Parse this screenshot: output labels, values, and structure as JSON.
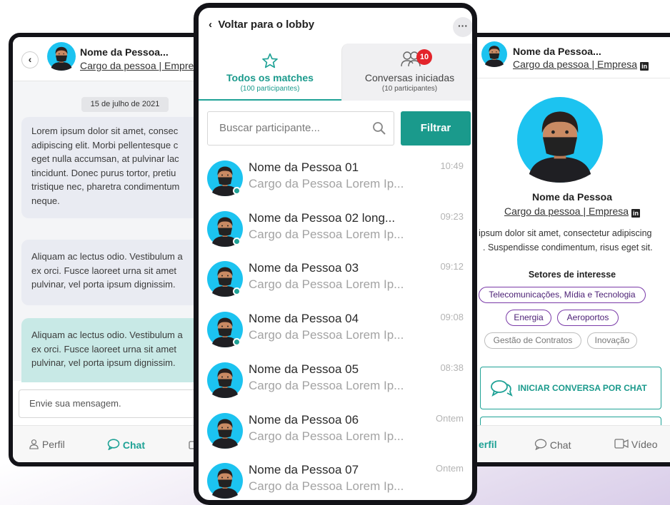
{
  "colors": {
    "teal": "#1fa296",
    "purple": "#7a3aa8",
    "badge": "#e3242b"
  },
  "left": {
    "name": "Nome da Pessoa...",
    "cargo": "Cargo da pessoa | Empre",
    "date": "15 de julho de 2021",
    "messages": [
      {
        "lines": [
          "Lorem ipsum dolor sit amet, consec",
          "adipiscing elit. Morbi pellentesque c",
          "eget nulla accumsan, at pulvinar lac",
          "tincidunt. Donec purus tortor, pretiu",
          "tristique nec, pharetra condimentum",
          "neque."
        ]
      },
      {
        "lines": [
          "Aliquam ac lectus odio. Vestibulum a",
          "ex orci. Fusce laoreet urna sit amet",
          "pulvinar, vel porta ipsum dignissim."
        ]
      },
      {
        "lines": [
          "Aliquam ac lectus odio. Vestibulum a",
          "ex orci. Fusce laoreet urna sit amet",
          "pulvinar, vel porta ipsum dignissim."
        ]
      }
    ],
    "input_placeholder": "Envie sua mensagem.",
    "tab_perfil": "Perfil",
    "tab_chat": "Chat"
  },
  "center": {
    "back": "Voltar para o lobby",
    "tab_all": "Todos os matches",
    "tab_all_count": "(100 participantes)",
    "tab_conv": "Conversas iniciadas",
    "tab_conv_count": "(10 participantes)",
    "badge": "10",
    "search_placeholder": "Buscar participante...",
    "filter": "Filtrar",
    "rows": [
      {
        "name": "Nome da Pessoa 01",
        "cargo": "Cargo da Pessoa Lorem Ip...",
        "time": "10:49",
        "online": true
      },
      {
        "name": "Nome da Pessoa 02 long...",
        "cargo": "Cargo da Pessoa Lorem Ip...",
        "time": "09:23",
        "online": true
      },
      {
        "name": "Nome da Pessoa 03",
        "cargo": "Cargo da Pessoa Lorem Ip...",
        "time": "09:12",
        "online": true
      },
      {
        "name": "Nome da Pessoa 04",
        "cargo": "Cargo da Pessoa Lorem Ip...",
        "time": "09:08",
        "online": true
      },
      {
        "name": "Nome da Pessoa 05",
        "cargo": "Cargo da Pessoa Lorem Ip...",
        "time": "08:38",
        "online": false
      },
      {
        "name": "Nome da Pessoa 06",
        "cargo": "Cargo da Pessoa Lorem Ip...",
        "time": "Ontem",
        "online": false
      },
      {
        "name": "Nome da Pessoa 07",
        "cargo": "Cargo da Pessoa Lorem Ip...",
        "time": "Ontem",
        "online": false
      }
    ]
  },
  "right": {
    "name": "Nome da Pessoa...",
    "cargo": "Cargo da pessoa | Empresa",
    "profile_name": "Nome da Pessoa",
    "profile_cargo": "Cargo da pessoa | Empresa",
    "bio_1": "ipsum dolor sit amet, consectetur adipiscing",
    "bio_2": ". Suspendisse condimentum, risus eget sit.",
    "sectors_title": "Setores de interesse",
    "chips_purple": [
      "Telecomunicações, Mídia e Tecnologia",
      "Energia",
      "Aeroportos"
    ],
    "chips_grey": [
      "Gestão de Contratos",
      "Inovação"
    ],
    "cta": "INICIAR CONVERSA POR CHAT",
    "tab_perfil": "erfil",
    "tab_chat": "Chat",
    "tab_video": "Vídeo"
  }
}
